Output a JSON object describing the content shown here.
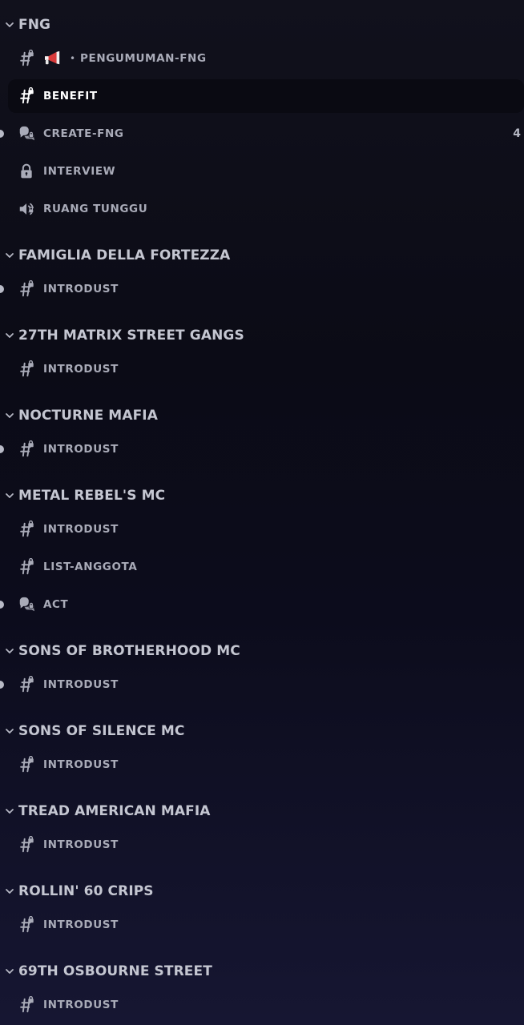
{
  "colors": {
    "text_muted": "#a9abb8",
    "text_selected": "#ffffff",
    "category_text": "#c4c6d1",
    "background_top": "#11111c",
    "background_bottom": "#161632",
    "unread_pill": "#b8bac6"
  },
  "categories": [
    {
      "name": "FNG",
      "channels": [
        {
          "label": "PENGUMUMAN-FNG",
          "icon": "hash-lock-icon",
          "prefix_emoji": "megaphone-icon",
          "separator": "•"
        },
        {
          "label": "BENEFIT",
          "icon": "hash-lock-icon",
          "selected": true
        },
        {
          "label": "CREATE-FNG",
          "icon": "forum-lock-icon",
          "unread": true,
          "badge": "4"
        },
        {
          "label": "INTERVIEW",
          "icon": "lock-icon"
        },
        {
          "label": "RUANG TUNGGU",
          "icon": "voice-lock-icon"
        }
      ]
    },
    {
      "name": "FAMIGLIA DELLA FORTEZZA",
      "channels": [
        {
          "label": "INTRODUST",
          "icon": "hash-lock-icon",
          "unread": true
        }
      ]
    },
    {
      "name": "27TH MATRIX STREET GANGS",
      "channels": [
        {
          "label": "INTRODUST",
          "icon": "hash-lock-icon"
        }
      ]
    },
    {
      "name": "NOCTURNE MAFIA",
      "channels": [
        {
          "label": "INTRODUST",
          "icon": "hash-lock-icon",
          "unread": true
        }
      ]
    },
    {
      "name": "METAL REBEL'S MC",
      "channels": [
        {
          "label": "INTRODUST",
          "icon": "hash-lock-icon"
        },
        {
          "label": "LIST-ANGGOTA",
          "icon": "hash-lock-icon"
        },
        {
          "label": "ACT",
          "icon": "forum-lock-icon",
          "unread": true
        }
      ]
    },
    {
      "name": "SONS OF BROTHERHOOD MC",
      "channels": [
        {
          "label": "INTRODUST",
          "icon": "hash-lock-icon",
          "unread": true
        }
      ]
    },
    {
      "name": "SONS OF SILENCE MC",
      "channels": [
        {
          "label": "INTRODUST",
          "icon": "hash-lock-icon"
        }
      ]
    },
    {
      "name": "TREAD AMERICAN MAFIA",
      "channels": [
        {
          "label": "INTRODUST",
          "icon": "hash-lock-icon"
        }
      ]
    },
    {
      "name": "ROLLIN' 60 CRIPS",
      "channels": [
        {
          "label": "INTRODUST",
          "icon": "hash-lock-icon"
        }
      ]
    },
    {
      "name": "69TH OSBOURNE STREET",
      "channels": [
        {
          "label": "INTRODUST",
          "icon": "hash-lock-icon"
        }
      ]
    }
  ]
}
